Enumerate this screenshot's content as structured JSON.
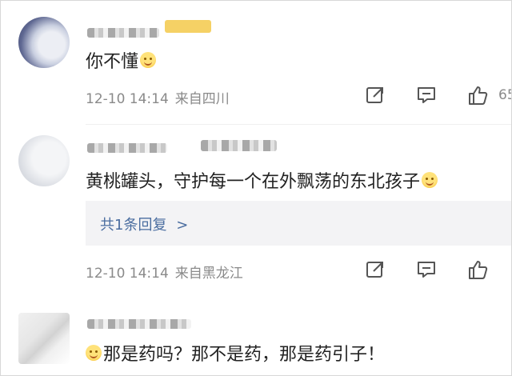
{
  "comments": [
    {
      "text": "你不懂",
      "time": "12-10 14:14",
      "location": "来自四川",
      "like_count": "65"
    },
    {
      "text": "黄桃罐头，守护每一个在外飘荡的东北孩子",
      "time": "12-10 14:14",
      "location": "来自黑龙江",
      "reply_label": "共1条回复",
      "reply_chevron": ">"
    },
    {
      "text": "那是药吗？那不是药，那是药引子！"
    }
  ],
  "icons": {
    "share": "share-icon",
    "comment": "comment-icon",
    "like": "thumbs-up-icon"
  }
}
